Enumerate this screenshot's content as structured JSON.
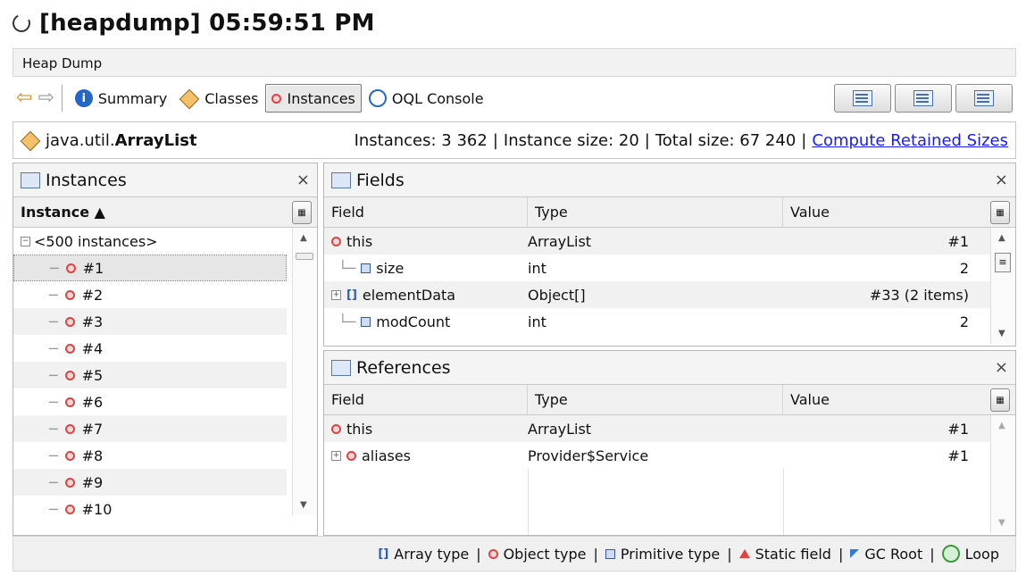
{
  "window": {
    "title": "[heapdump] 05:59:51 PM"
  },
  "tab": {
    "label": "Heap Dump"
  },
  "toolbar": {
    "summary": "Summary",
    "classes": "Classes",
    "instances": "Instances",
    "oql": "OQL Console"
  },
  "classbar": {
    "package": "java.util.",
    "class_name": "ArrayList",
    "instances": "Instances: 3 362",
    "instance_size": "Instance size: 20",
    "total_size": "Total size: 67 240",
    "sep": "|",
    "compute_link": "Compute Retained Sizes"
  },
  "instances_panel": {
    "title": "Instances",
    "close": "×",
    "column": "Instance ▲",
    "group": "<500 instances>",
    "items": [
      "#1",
      "#2",
      "#3",
      "#4",
      "#5",
      "#6",
      "#7",
      "#8",
      "#9",
      "#10"
    ]
  },
  "fields_panel": {
    "title": "Fields",
    "close": "×",
    "columns": [
      "Field",
      "Type",
      "Value"
    ],
    "rows": [
      {
        "field": "this",
        "type": "ArrayList",
        "value": "#1"
      },
      {
        "field": "size",
        "type": "int",
        "value": "2"
      },
      {
        "field": "elementData",
        "type": "Object[]",
        "value": "#33 (2 items)"
      },
      {
        "field": "modCount",
        "type": "int",
        "value": "2"
      }
    ]
  },
  "references_panel": {
    "title": "References",
    "close": "×",
    "columns": [
      "Field",
      "Type",
      "Value"
    ],
    "rows": [
      {
        "field": "this",
        "type": "ArrayList",
        "value": "#1"
      },
      {
        "field": "aliases",
        "type": "Provider$Service",
        "value": "#1"
      }
    ]
  },
  "legend": {
    "array": "Array type",
    "object": "Object type",
    "primitive": "Primitive type",
    "static": "Static field",
    "gc": "GC Root",
    "loop": "Loop",
    "sep": "|"
  }
}
